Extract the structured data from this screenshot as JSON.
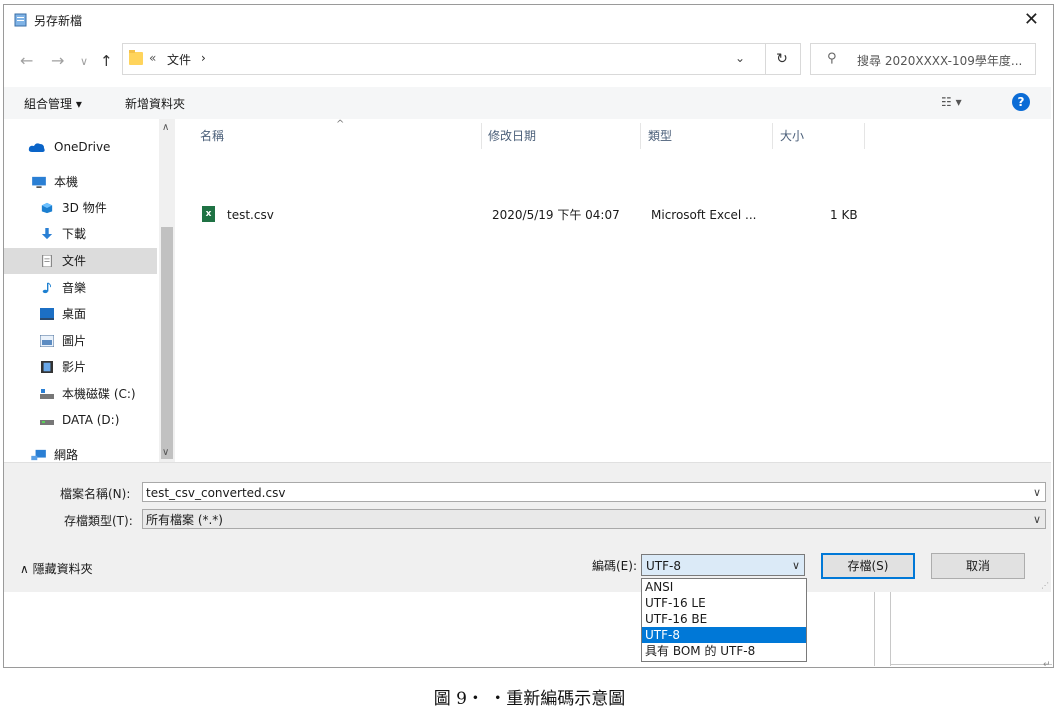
{
  "window": {
    "title": "另存新檔",
    "close_glyph": "✕"
  },
  "address": {
    "back_glyph": "←",
    "forward_glyph": "→",
    "history_glyph": "∨",
    "up_glyph": "↑",
    "crumb_prefix": "«",
    "crumb": "文件",
    "crumb_sep": "›",
    "chevron": "⌄",
    "refresh_glyph": "↻",
    "search_placeholder": "搜尋 2020XXXX-109學年度..."
  },
  "toolbar": {
    "organize": "組合管理 ▾",
    "new_folder": "新增資料夾",
    "view_glyph": "☷ ▾",
    "help_glyph": "?"
  },
  "nav": {
    "items": [
      {
        "label": "OneDrive",
        "icon": "cloud-icon"
      },
      {
        "label": "本機",
        "icon": "computer-icon"
      },
      {
        "label": "3D 物件",
        "icon": "cube-icon"
      },
      {
        "label": "下載",
        "icon": "download-icon"
      },
      {
        "label": "文件",
        "icon": "document-icon",
        "selected": true
      },
      {
        "label": "音樂",
        "icon": "music-icon"
      },
      {
        "label": "桌面",
        "icon": "desktop-icon"
      },
      {
        "label": "圖片",
        "icon": "picture-icon"
      },
      {
        "label": "影片",
        "icon": "video-icon"
      },
      {
        "label": "本機磁碟 (C:)",
        "icon": "drive-icon"
      },
      {
        "label": "DATA (D:)",
        "icon": "drive-icon"
      },
      {
        "label": "網路",
        "icon": "network-icon"
      }
    ],
    "scroll_up": "∧",
    "scroll_down": "∨"
  },
  "columns": {
    "name": "名稱",
    "modified": "修改日期",
    "type": "類型",
    "size": "大小",
    "sort_glyph": "^"
  },
  "files": [
    {
      "name": "test.csv",
      "modified": "2020/5/19 下午 04:07",
      "type": "Microsoft Excel ...",
      "size": "1 KB",
      "icon_text": "x"
    }
  ],
  "form": {
    "filename_label": "檔案名稱(N):",
    "filename_value": "test_csv_converted.csv",
    "type_label": "存檔類型(T):",
    "type_value": "所有檔案 (*.*)",
    "dd_glyph": "∨",
    "hide_folders": "∧ 隱藏資料夾",
    "encoding_label": "編碼(E):",
    "encoding_value": "UTF-8",
    "save_button": "存檔(S)",
    "cancel_button": "取消",
    "encoding_options": [
      "ANSI",
      "UTF-16 LE",
      "UTF-16 BE",
      "UTF-8",
      "具有 BOM 的 UTF-8"
    ],
    "encoding_selected_index": 3
  },
  "document": {
    "caption": "圖 9‧ ‧重新編碼示意圖",
    "para_mark": "↵"
  },
  "colors": {
    "accent": "#0078d7",
    "selected_nav": "#dcdcdc",
    "toolbar_bg": "#f5f6f7",
    "panel_bg": "#f0f0f0"
  }
}
